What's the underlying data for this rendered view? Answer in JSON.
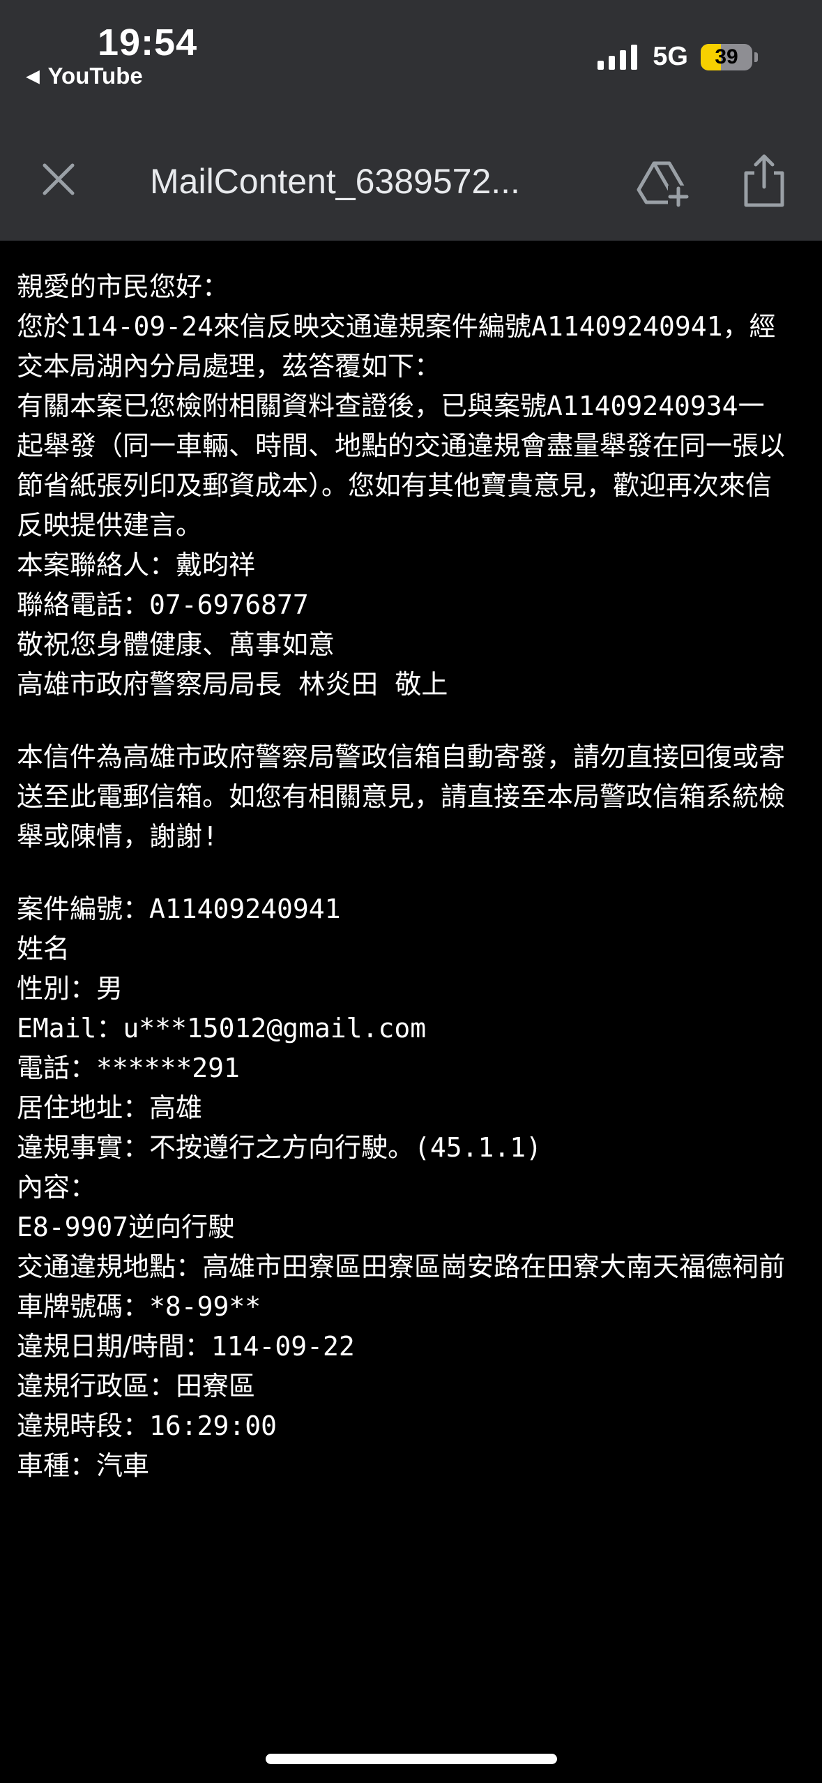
{
  "status_bar": {
    "time": "19:54",
    "back_app": "YouTube",
    "network": "5G",
    "battery": "39",
    "battery_level": 0.39
  },
  "toolbar": {
    "title": "MailContent_6389572..."
  },
  "icons": {
    "close": "close-icon",
    "add_to_drive": "add-to-drive-icon",
    "share": "share-icon",
    "back": "back-triangle-icon"
  },
  "colors": {
    "header_bg": "#303134",
    "body_bg": "#000000",
    "battery_fill": "#f7d000",
    "text": "#ffffff"
  },
  "email": {
    "reply": {
      "l1": "親愛的市民您好：",
      "l2a": "您於",
      "l2b": "114-09-24",
      "l2c": "來信反映交通違規案件編號",
      "l2d": "A11409240941，",
      "l2e": "經",
      "l3": "交本局湖內分局處理，茲答覆如下：",
      "l4a": "有關本案已您檢附相關資料查證後，已與案號",
      "l4b": "A11409240934",
      "l4c": "一",
      "l5": "起舉發（同一車輛、時間、地點的交通違規會盡量舉發在同一張以",
      "l6": "節省紙張列印及郵資成本）。您如有其他寶貴意見，歡迎再次來信",
      "l7": "反映提供建言。",
      "l8": "本案聯絡人：戴昀祥",
      "l9a": "聯絡電話：",
      "l9b": "07-6976877",
      "l10": "敬祝您身體健康、萬事如意",
      "l11": "高雄市政府警察局局長  林炎田  敬上"
    },
    "notice": {
      "l1": "本信件為高雄市政府警察局警政信箱自動寄發，請勿直接回復或寄",
      "l2": "送至此電郵信箱。如您有相關意見，請直接至本局警政信箱系統檢",
      "l3a": "舉或陳情，謝謝",
      "l3b": "!"
    },
    "case": {
      "id_label": "案件編號：",
      "id_value": "A11409240941",
      "name_label": "姓名",
      "gender": "性別：男",
      "email_label": "EMail：",
      "email_value": "u***15012@gmail.com",
      "phone_label": "電話：",
      "phone_value": "******291",
      "address_label": "居住地址：",
      "address_value": "高雄",
      "violation_label": "違規事實：",
      "violation_value": "不按遵行之方向行駛。",
      "violation_code": "(45.1.1)",
      "content_label": "內容：",
      "content_a": "E8-9907",
      "content_b": "逆向行駛",
      "location": "交通違規地點：高雄市田寮區田寮區崗安路在田寮大南天福德祠前",
      "plate_label": "車牌號碼：",
      "plate_value": "*8-99**",
      "date_label": "違規日期/時間：",
      "date_value": "114-09-22",
      "district": "違規行政區：田寮區",
      "period_label": "違規時段：",
      "period_value": "16:29:00",
      "vehicle": "車種：汽車"
    }
  }
}
